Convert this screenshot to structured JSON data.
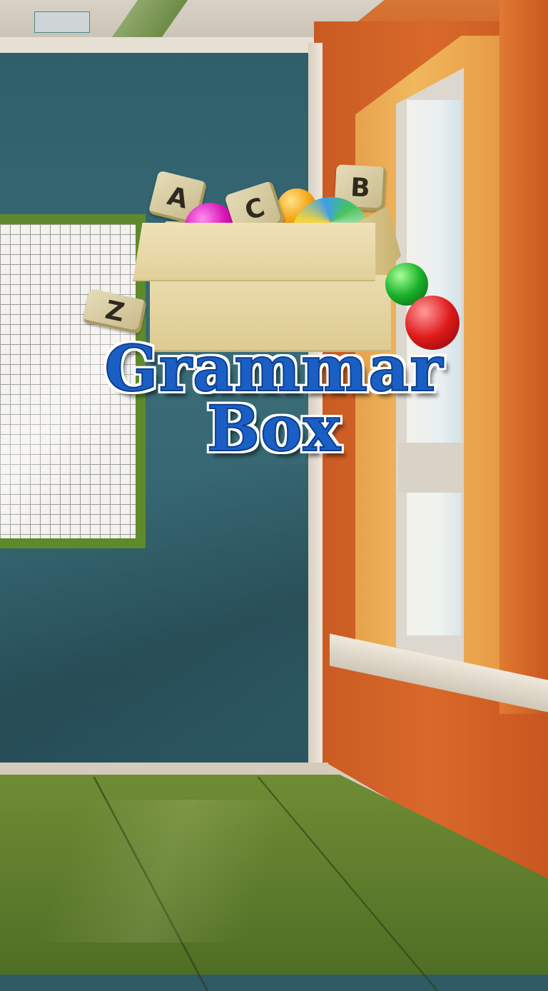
{
  "logo": {
    "title_line1": "Grammar",
    "title_line2": "Box",
    "blocks": [
      "A",
      "C",
      "B",
      "Z"
    ]
  },
  "colors": {
    "title_fill": "#1b5fc4",
    "title_outline": "#0b3f8f",
    "wall_teal": "#2f5f6a",
    "wall_orange": "#d9692a",
    "floor_green": "#5c7a2b"
  },
  "scene": {
    "background": "classroom",
    "icons": [
      "letter-block-icon",
      "ball-icon",
      "beach-ball-icon",
      "cardboard-box-icon"
    ]
  }
}
